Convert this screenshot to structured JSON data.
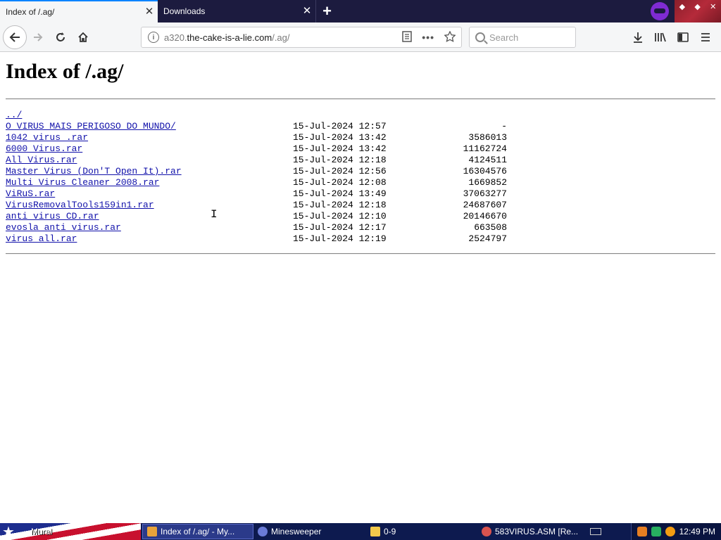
{
  "browser": {
    "tabs": [
      {
        "label": "Index of /.ag/",
        "active": true
      },
      {
        "label": "Downloads",
        "active": false
      }
    ],
    "new_tab_label": "+",
    "close_glyph": "✕",
    "url": {
      "prefix": "a320.",
      "host": "the-cake-is-a-lie.com",
      "path": "/.ag/"
    },
    "search_placeholder": "Search",
    "icons": [
      "back-arrow-icon",
      "forward-arrow-icon",
      "reload-icon",
      "home-icon",
      "info-icon",
      "reader-view-icon",
      "page-actions-icon",
      "bookmark-star-icon",
      "search-icon",
      "download-icon",
      "library-icon",
      "sidebar-icon",
      "menu-icon",
      "private-mask-icon"
    ]
  },
  "page": {
    "title": "Index of /.ag/",
    "parent_link": "../",
    "entries": [
      {
        "name": "O VIRUS MAIS PERIGOSO DO MUNDO/",
        "date": "15-Jul-2024 12:57",
        "size": "-"
      },
      {
        "name": "1042 virus .rar",
        "date": "15-Jul-2024 13:42",
        "size": "3586013"
      },
      {
        "name": "6000 Virus.rar",
        "date": "15-Jul-2024 13:42",
        "size": "11162724"
      },
      {
        "name": "All Virus.rar",
        "date": "15-Jul-2024 12:18",
        "size": "4124511"
      },
      {
        "name": "Master Virus (Don'T Open It).rar",
        "date": "15-Jul-2024 12:56",
        "size": "16304576"
      },
      {
        "name": "Multi Virus Cleaner 2008.rar",
        "date": "15-Jul-2024 12:08",
        "size": "1669852"
      },
      {
        "name": "ViRuS.rar",
        "date": "15-Jul-2024 13:49",
        "size": "37063277"
      },
      {
        "name": "VirusRemovalTools159in1.rar",
        "date": "15-Jul-2024 12:18",
        "size": "24687607"
      },
      {
        "name": "anti virus CD.rar",
        "date": "15-Jul-2024 12:10",
        "size": "20146670"
      },
      {
        "name": "evosla anti virus.rar",
        "date": "15-Jul-2024 12:17",
        "size": "663508"
      },
      {
        "name": "virus all.rar",
        "date": "15-Jul-2024 12:19",
        "size": "2524797"
      }
    ]
  },
  "taskbar": {
    "start_label": "Mural",
    "tasks": [
      {
        "label": "Index of /.ag/ - My...",
        "active": true
      },
      {
        "label": "Minesweeper",
        "active": false
      },
      {
        "label": "0-9",
        "active": false
      },
      {
        "label": "583VIRUS.ASM [Re...",
        "active": false
      }
    ],
    "clock": "12:49 PM"
  },
  "colors": {
    "tabstrip": "#1c1b3f",
    "accent": "#0a84ff",
    "link": "#1111aa",
    "taskbar": "#0d1a4f"
  }
}
